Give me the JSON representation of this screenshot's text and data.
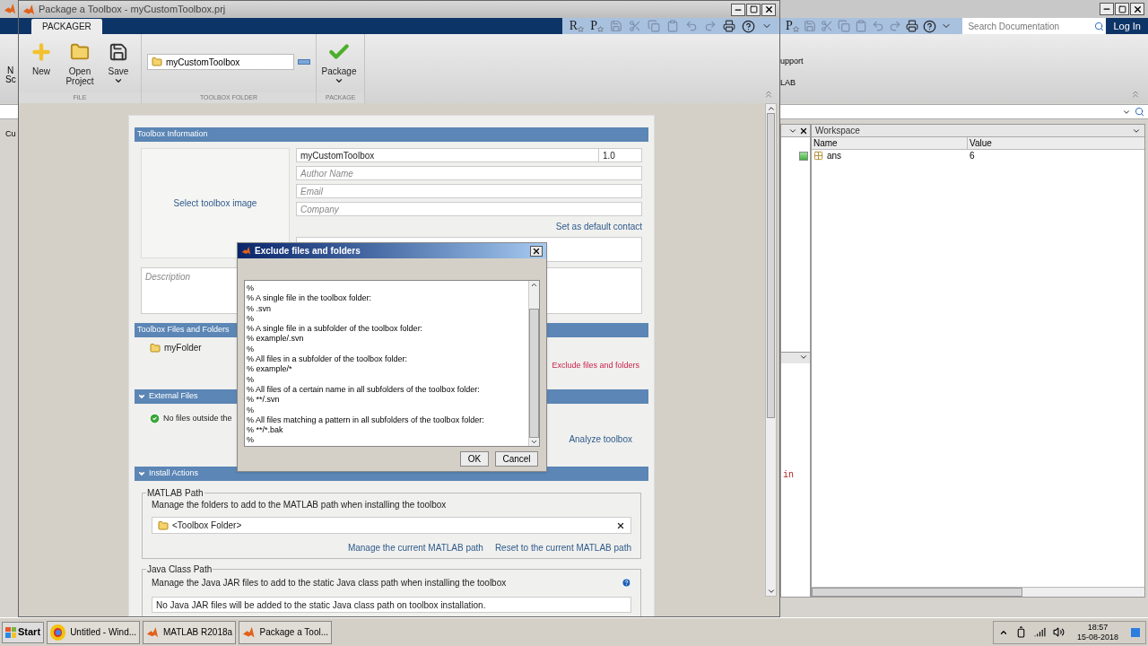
{
  "desktop": {
    "left_fragments": [
      "N",
      "Sc",
      "Cu"
    ],
    "quick_access_letters": [
      "P"
    ],
    "search": {
      "placeholder": "Search Documentation"
    },
    "login": "Log In",
    "ribbon_fragments": [
      "upport",
      "LAB"
    ],
    "workspace": {
      "title": "Workspace",
      "columns": [
        "Name",
        "Value"
      ],
      "rows": [
        {
          "name": "ans",
          "value": "6"
        }
      ]
    },
    "command_fragment": "in"
  },
  "packager": {
    "title": "Package a Toolbox - myCustomToolbox.prj",
    "tabs": [
      {
        "label": "PACKAGER",
        "selected": true
      }
    ],
    "quick_access_letters": [
      "R",
      "P"
    ],
    "groups": [
      {
        "label": "FILE",
        "kind": "buttons",
        "buttons": [
          {
            "label": "New",
            "kind": "new"
          },
          {
            "label": "Open Project",
            "kind": "open"
          },
          {
            "label": "Save",
            "kind": "save",
            "dropdown": true
          }
        ]
      },
      {
        "label": "TOOLBOX FOLDER",
        "kind": "folder",
        "folder": "myCustomToolbox"
      },
      {
        "label": "PACKAGE",
        "kind": "buttons",
        "buttons": [
          {
            "label": "Package",
            "kind": "package",
            "dropdown": true
          }
        ]
      }
    ],
    "sections": [
      {
        "kind": "info",
        "title": "Toolbox Information",
        "image_link": "Select toolbox image",
        "name": "myCustomToolbox",
        "version": "1.0",
        "fields": [
          {
            "placeholder": "Author Name"
          },
          {
            "placeholder": "Email"
          },
          {
            "placeholder": "Company"
          }
        ],
        "contact_link": "Set as default contact",
        "description": {
          "placeholder": "Description"
        }
      },
      {
        "kind": "files",
        "title": "Toolbox Files and Folders",
        "folder": "myFolder",
        "link": "Exclude files and folders"
      },
      {
        "kind": "external",
        "title": "External Files",
        "expanded": true,
        "status": "No files outside the",
        "link": "Analyze toolbox"
      },
      {
        "kind": "install",
        "title": "Install Actions",
        "expanded": true,
        "matlab_path": {
          "legend": "MATLAB Path",
          "text": "Manage the folders to add to the MATLAB path when installing the toolbox",
          "items": [
            "<Toolbox Folder>"
          ],
          "links": [
            "Manage the current MATLAB path",
            "Reset to the current MATLAB path"
          ]
        },
        "java_path": {
          "legend": "Java Class Path",
          "text": "Manage the Java JAR files to add to the static Java class path when installing the toolbox",
          "note": "No Java JAR files will be added to the static Java class path on toolbox installation."
        }
      }
    ]
  },
  "dialog": {
    "title": "Exclude files and folders",
    "lines": [
      "%",
      "% A single file in the toolbox folder:",
      "% .svn",
      "%",
      "% A single file in a subfolder of the toolbox folder:",
      "% example/.svn",
      "%",
      "% All files in a subfolder of the toolbox folder:",
      "% example/*",
      "%",
      "% All files of a certain name in all subfolders of the toolbox folder:",
      "% **/.svn",
      "%",
      "% All files matching a pattern in all subfolders of the toolbox folder:",
      "% **/*.bak",
      "%"
    ],
    "buttons": [
      "OK",
      "Cancel"
    ]
  },
  "taskbar": {
    "start": "Start",
    "tasks": [
      {
        "label": "Untitled - Wind...",
        "kind": "browser"
      },
      {
        "label": "MATLAB R2018a",
        "kind": "matlab"
      },
      {
        "label": "Package a Tool...",
        "kind": "matlab"
      }
    ],
    "time": "18:57",
    "date": "15-08-2018"
  }
}
